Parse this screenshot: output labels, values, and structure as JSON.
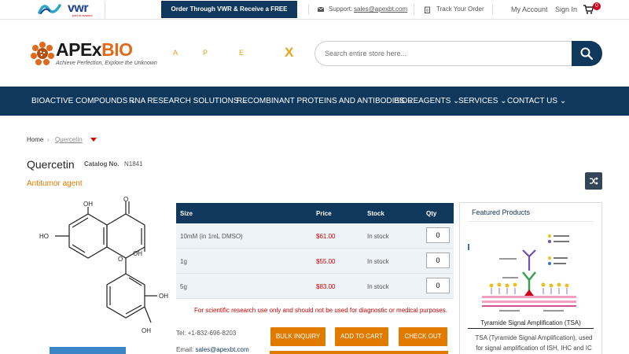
{
  "topbar": {
    "vwr_logo": "vwr",
    "vwr_tagline": "part of avantor",
    "vwr_cta": "Order Through VWR & Receive a FREE Sample",
    "support_label": "Support:",
    "support_email": "sales@apexbt.com",
    "track_order": "Track Your Order",
    "my_account": "My Account",
    "sign_in": "Sign In",
    "cart_count": "0"
  },
  "header": {
    "logo_main": "APEx",
    "logo_accent": "BIO",
    "logo_tagline": "Achieve Perfection, Explore the Unknown",
    "deco_letters": [
      "A",
      "P",
      "E",
      "X"
    ],
    "search_placeholder": "Search entire store here..."
  },
  "nav": {
    "items": [
      {
        "label": "BIOACTIVE COMPOUNDS"
      },
      {
        "label": "RNA RESEARCH SOLUTIONS"
      },
      {
        "label": "RECOMBINANT PROTEINS AND ANTIBODIES"
      },
      {
        "label": "BIOREAGENTS"
      },
      {
        "label": "SERVICES"
      },
      {
        "label": "CONTACT US"
      }
    ]
  },
  "breadcrumb": {
    "home": "Home",
    "current": "Quercetin"
  },
  "product": {
    "name": "Quercetin",
    "catalog_label": "Catalog No.",
    "catalog_no": "N1841",
    "subtitle": "Antitumor agent",
    "structure_labels": {
      "oh_top": "OH",
      "oh_left": "HO",
      "oh_mid": "OH",
      "ring_o": "O",
      "keto_o": "O",
      "oh_right": "OH",
      "oh_bottom": "OH"
    }
  },
  "table": {
    "headers": {
      "size": "Size",
      "price": "Price",
      "stock": "Stock",
      "qty": "Qty"
    },
    "rows": [
      {
        "size": "10mM (in 1mL DMSO)",
        "price": "$61.00",
        "stock": "In stock",
        "qty": "0"
      },
      {
        "size": "1g",
        "price": "$55.00",
        "stock": "In stock",
        "qty": "0"
      },
      {
        "size": "5g",
        "price": "$83.00",
        "stock": "In stock",
        "qty": "0"
      }
    ],
    "disclaimer": "For scientific research use only and should not be used for diagnostic or medical purposes."
  },
  "contact": {
    "tel_label": "Tel:",
    "tel": "+1-832-696-8203",
    "email_label": "Email:",
    "email": "sales@apexbt.com"
  },
  "actions": {
    "bulk_inquiry": "BULK INQUIRY",
    "add_to_cart": "ADD TO CART",
    "check_out": "CHECK OUT"
  },
  "featured": {
    "title": "Featured Products",
    "name": "Tyramide Signal Amplification (TSA)",
    "description": "TSA (Tyramide Signal Amplification), used for signal amplification of ISH, IHC and IC"
  },
  "colors": {
    "navy": "#10375c",
    "orange": "#e07b00",
    "red": "#cc0000"
  }
}
